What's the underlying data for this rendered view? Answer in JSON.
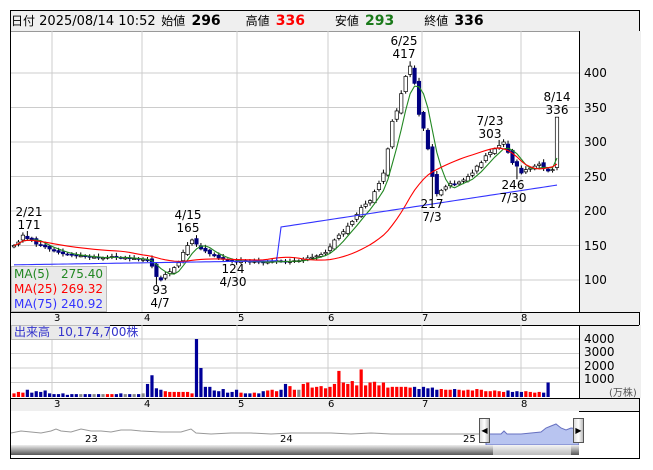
{
  "header": {
    "date_label": "日付",
    "date": "2025/08/14 10:52",
    "open_label": "始値",
    "open": "296",
    "high_label": "高値",
    "high": "336",
    "low_label": "安値",
    "low": "293",
    "close_label": "終値",
    "close": "336"
  },
  "colors": {
    "up_fill": "#ffffff",
    "down_fill": "#000080",
    "vol_up": "#ff0000",
    "vol_down": "#000099",
    "vol_flat": "#888888",
    "ma5": "#228822",
    "ma25": "#ff0000",
    "ma75": "#3333ff"
  },
  "price_axis": {
    "ticks": [
      "400",
      "350",
      "300",
      "250",
      "200",
      "150",
      "100"
    ],
    "values": [
      400,
      350,
      300,
      250,
      200,
      150,
      100
    ]
  },
  "months": [
    "3",
    "4",
    "5",
    "6",
    "7",
    "8"
  ],
  "ma_legend": [
    {
      "name": "MA(5)",
      "value": "275.40"
    },
    {
      "name": "MA(25)",
      "value": "269.32"
    },
    {
      "name": "MA(75)",
      "value": "240.92"
    }
  ],
  "annotations": [
    {
      "date": "2/21",
      "price": "171"
    },
    {
      "date": "4/15",
      "price": "165"
    },
    {
      "date": "4/7",
      "price": "93"
    },
    {
      "date": "4/30",
      "price": "124"
    },
    {
      "date": "6/25",
      "price": "417"
    },
    {
      "date": "7/3",
      "price": "217"
    },
    {
      "date": "7/23",
      "price": "303"
    },
    {
      "date": "7/30",
      "price": "246"
    },
    {
      "date": "8/14",
      "price": "336"
    }
  ],
  "volume": {
    "label": "出来高",
    "total": "10,174,700株",
    "ticks": [
      "4000",
      "3000",
      "2000",
      "1000"
    ],
    "tick_values": [
      4000,
      3000,
      2000,
      1000
    ],
    "unit": "(万株)"
  },
  "navigator": {
    "labels": [
      "23",
      "24",
      "25"
    ]
  },
  "chart_data": {
    "type": "candlestick",
    "closes": [
      150,
      155,
      165,
      160,
      158,
      152,
      150,
      148,
      145,
      142,
      140,
      138,
      137,
      136,
      135,
      135,
      134,
      133,
      133,
      132,
      132,
      133,
      134,
      133,
      132,
      132,
      131,
      131,
      130,
      130,
      128,
      120,
      105,
      100,
      108,
      112,
      118,
      125,
      140,
      150,
      158,
      152,
      145,
      142,
      138,
      135,
      132,
      130,
      128,
      127,
      126,
      128,
      127,
      126,
      127,
      126,
      125,
      126,
      127,
      128,
      127,
      126,
      127,
      128,
      128,
      130,
      132,
      133,
      135,
      137,
      140,
      148,
      158,
      165,
      170,
      178,
      185,
      195,
      205,
      210,
      215,
      228,
      240,
      255,
      290,
      330,
      345,
      370,
      395,
      410,
      385,
      340,
      320,
      290,
      250,
      225,
      230,
      235,
      240,
      238,
      242,
      245,
      250,
      255,
      265,
      270,
      280,
      285,
      290,
      295,
      300,
      285,
      270,
      265,
      255,
      260,
      262,
      265,
      268,
      262,
      258,
      260,
      336
    ],
    "volumes": [
      250,
      350,
      300,
      500,
      300,
      400,
      350,
      450,
      250,
      200,
      200,
      250,
      150,
      200,
      200,
      200,
      200,
      200,
      200,
      200,
      200,
      200,
      200,
      200,
      250,
      200,
      200,
      200,
      200,
      250,
      900,
      1500,
      600,
      500,
      400,
      350,
      350,
      350,
      350,
      350,
      250,
      4000,
      2000,
      700,
      700,
      450,
      400,
      550,
      300,
      350,
      500,
      300,
      250,
      250,
      300,
      250,
      400,
      450,
      500,
      400,
      500,
      900,
      750,
      500,
      500,
      900,
      1000,
      650,
      700,
      750,
      600,
      700,
      900,
      1800,
      1000,
      900,
      1100,
      800,
      1900,
      800,
      1000,
      1050,
      800,
      1000,
      650,
      700,
      700,
      700,
      700,
      650,
      700,
      550,
      700,
      600,
      650,
      500,
      550,
      500,
      500,
      550,
      500,
      450,
      500,
      450,
      550,
      500,
      400,
      400,
      450,
      400,
      350,
      450,
      350,
      400,
      350,
      400,
      350,
      300,
      350,
      300,
      1000
    ]
  }
}
